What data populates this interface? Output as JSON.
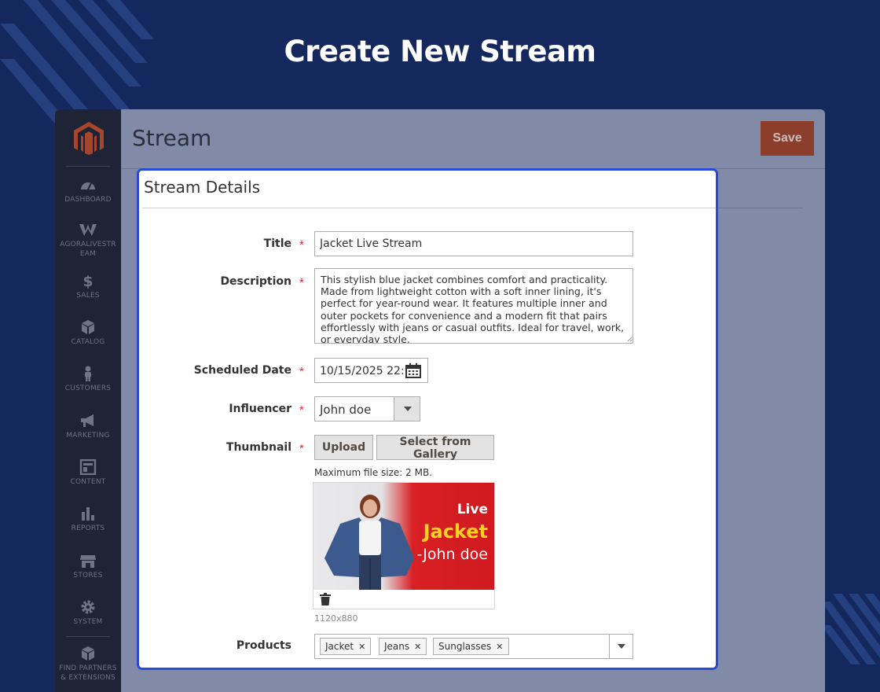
{
  "banner": {
    "title": "Create New Stream"
  },
  "header": {
    "page_title": "Stream",
    "save_label": "Save"
  },
  "sidebar": {
    "items": [
      {
        "label": "DASHBOARD",
        "icon": "dashboard-icon"
      },
      {
        "label": "AGORALIVESTR EAM",
        "icon": "agora-icon"
      },
      {
        "label": "SALES",
        "icon": "dollar-icon"
      },
      {
        "label": "CATALOG",
        "icon": "box-icon"
      },
      {
        "label": "CUSTOMERS",
        "icon": "person-icon"
      },
      {
        "label": "MARKETING",
        "icon": "megaphone-icon"
      },
      {
        "label": "CONTENT",
        "icon": "layout-icon"
      },
      {
        "label": "REPORTS",
        "icon": "bar-chart-icon"
      },
      {
        "label": "STORES",
        "icon": "storefront-icon"
      },
      {
        "label": "SYSTEM",
        "icon": "gear-icon"
      },
      {
        "label": "FIND PARTNERS & EXTENSIONS",
        "icon": "cubes-icon"
      }
    ]
  },
  "form": {
    "section_title": "Stream Details",
    "title": {
      "label": "Title",
      "value": "Jacket Live Stream"
    },
    "description": {
      "label": "Description",
      "value": "This stylish blue jacket combines comfort and practicality. Made from lightweight cotton with a soft inner lining, it's perfect for year-round wear. It features multiple inner and outer pockets for convenience and a modern fit that pairs effortlessly with jeans or casual outfits. Ideal for travel, work, or everyday style."
    },
    "scheduled_date": {
      "label": "Scheduled Date",
      "value": "10/15/2025   22:"
    },
    "influencer": {
      "label": "Influencer",
      "value": "John doe"
    },
    "thumbnail": {
      "label": "Thumbnail",
      "upload_label": "Upload",
      "gallery_label": "Select from Gallery",
      "max_size_note": "Maximum file size: 2 MB.",
      "image_text_live": "Live",
      "image_text_product": "Jacket",
      "image_text_name": "-John doe",
      "dimensions": "1120x880"
    },
    "products": {
      "label": "Products",
      "tags": [
        "Jacket",
        "Jeans",
        "Sunglasses"
      ]
    }
  },
  "colors": {
    "accent_border": "#2a49d6",
    "save_button": "#8c3e2d",
    "required_star": "#e02b27",
    "background": "#14285e"
  }
}
